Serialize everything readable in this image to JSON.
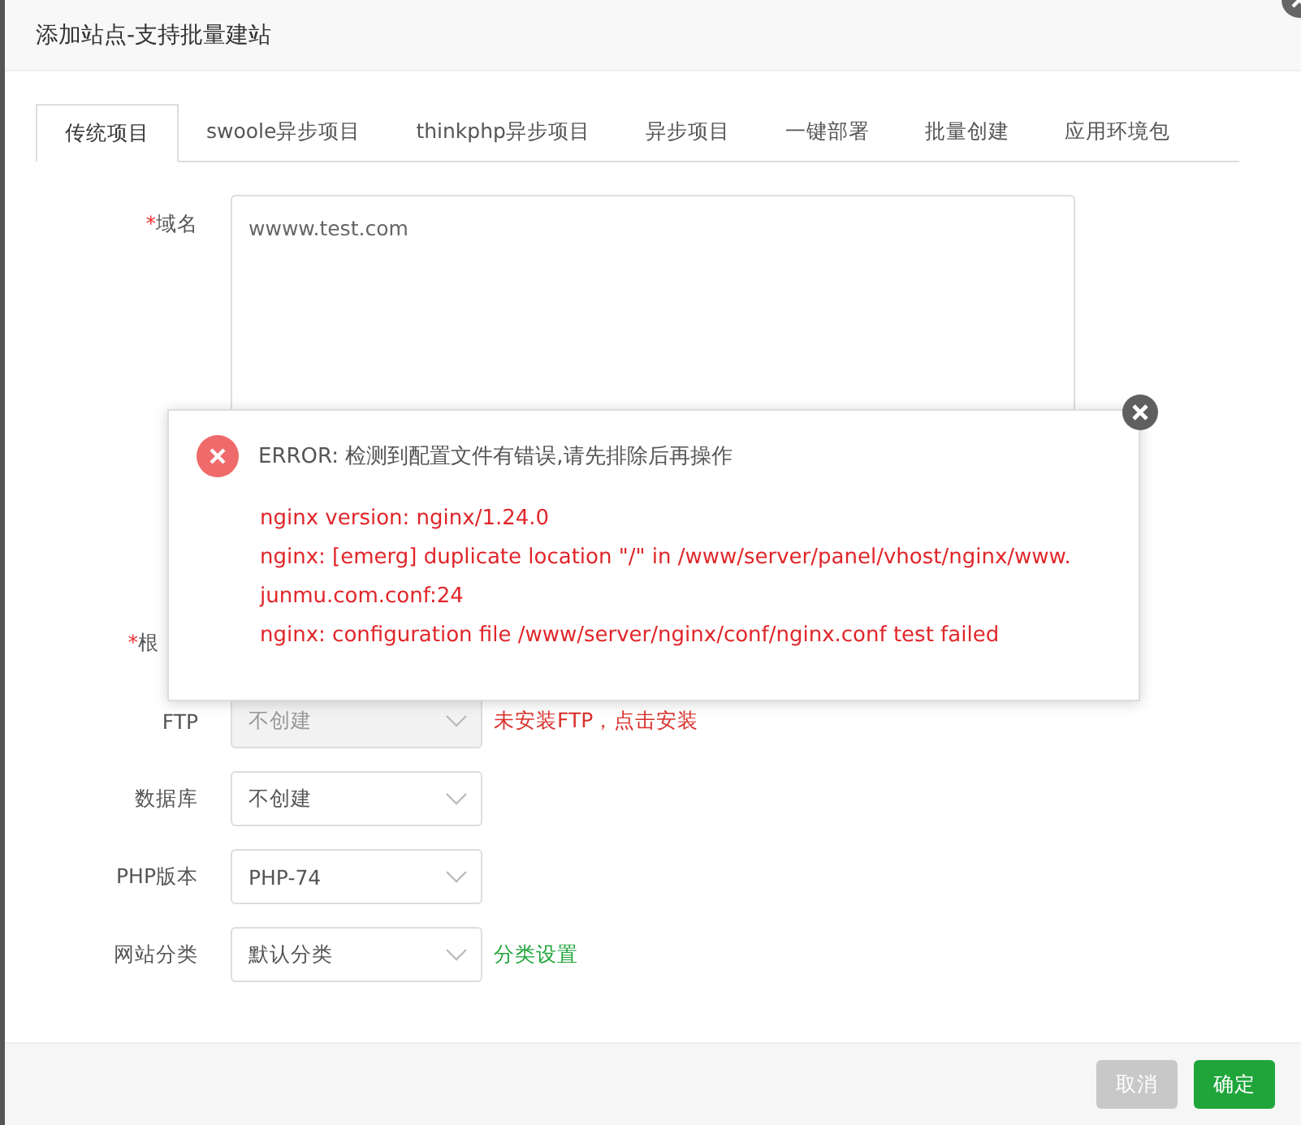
{
  "dialog": {
    "title": "添加站点-支持批量建站"
  },
  "tabs": [
    {
      "label": "传统项目",
      "selected": true
    },
    {
      "label": "swoole异步项目",
      "selected": false
    },
    {
      "label": "thinkphp异步项目",
      "selected": false
    },
    {
      "label": "异步项目",
      "selected": false
    },
    {
      "label": "一键部署",
      "selected": false
    },
    {
      "label": "批量创建",
      "selected": false
    },
    {
      "label": "应用环境包",
      "selected": false
    }
  ],
  "domain": {
    "mark": "*",
    "label": "域名",
    "value": "wwww.test.com"
  },
  "rows": [
    {
      "kind": "covered",
      "mark": "*",
      "label": "根"
    },
    {
      "kind": "select",
      "label": "FTP",
      "value": "不创建",
      "disabled": true,
      "warning": "未安装FTP，点击安装"
    },
    {
      "kind": "select",
      "label": "数据库",
      "value": "不创建",
      "disabled": false
    },
    {
      "kind": "select",
      "label": "PHP版本",
      "value": "PHP-74",
      "disabled": false
    },
    {
      "kind": "select",
      "label": "网站分类",
      "value": "默认分类",
      "disabled": false,
      "link": "分类设置"
    }
  ],
  "buttons": [
    {
      "label": "取消",
      "kind": "cancel"
    },
    {
      "label": "确定",
      "kind": "primary"
    }
  ],
  "error_popup": {
    "heading": "ERROR: 检测到配置文件有错误,请先排除后再操作",
    "lines": [
      "nginx version: nginx/1.24.0",
      "nginx: [emerg] duplicate location \"/\" in /www/server/panel/vhost/nginx/www.",
      "junmu.com.conf:24",
      "nginx: configuration file /www/server/nginx/conf/nginx.conf test failed"
    ]
  }
}
